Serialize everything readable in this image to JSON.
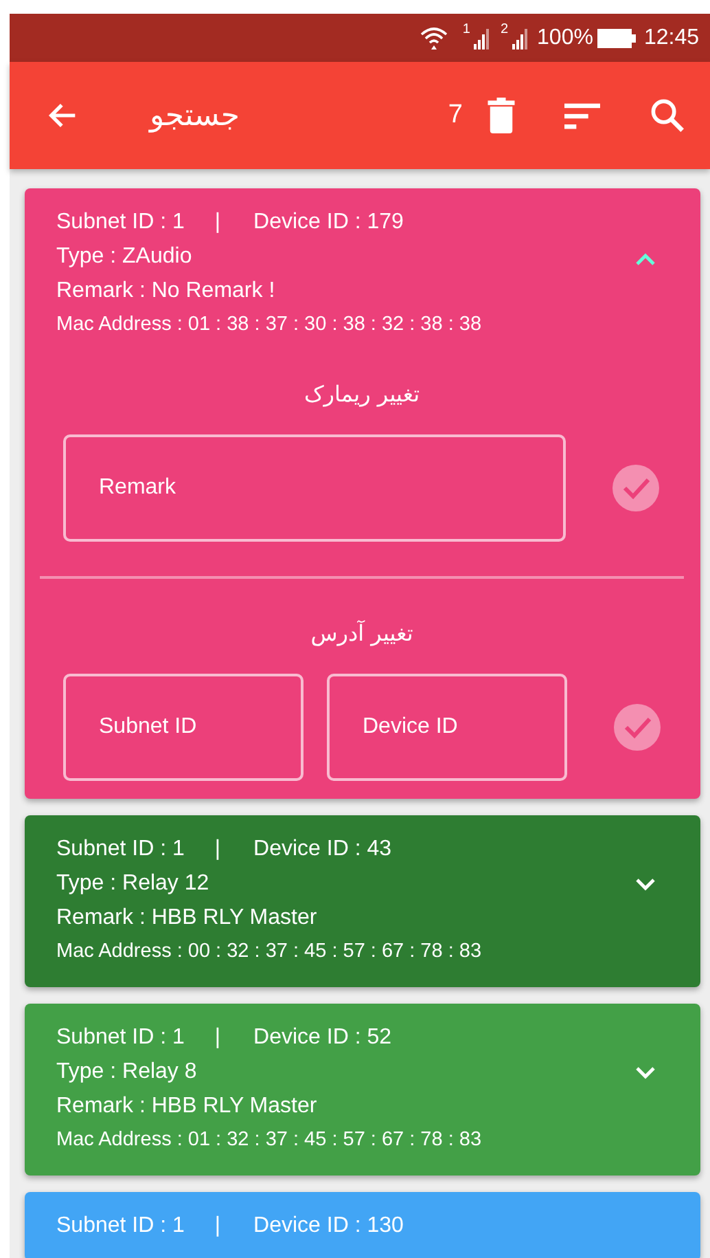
{
  "status_bar": {
    "sim_labels": [
      "1",
      "2"
    ],
    "battery": "100%",
    "time": "12:45"
  },
  "toolbar": {
    "title": "جستجو",
    "count": "7"
  },
  "devices": [
    {
      "color": "#ec407a",
      "expanded": true,
      "subnet": "Subnet ID : 1",
      "separator": "|",
      "device": "Device ID : 179",
      "type": "Type : ZAudio",
      "remark": "Remark : No Remark !",
      "mac": "Mac Address : 01 : 38 : 37 : 30 : 38 : 32 : 38 : 38",
      "edit": {
        "remark_title": "تغییر ریمارک",
        "remark_placeholder": "Remark",
        "address_title": "تغییر آدرس",
        "subnet_placeholder": "Subnet ID",
        "device_placeholder": "Device ID"
      }
    },
    {
      "color": "#2e7d32",
      "expanded": false,
      "subnet": "Subnet ID : 1",
      "separator": "|",
      "device": "Device ID : 43",
      "type": "Type : Relay 12",
      "remark": "Remark : HBB RLY Master",
      "mac": "Mac Address : 00 : 32 : 37 : 45 : 57 : 67 : 78 : 83"
    },
    {
      "color": "#43a047",
      "expanded": false,
      "subnet": "Subnet ID : 1",
      "separator": "|",
      "device": "Device ID : 52",
      "type": "Type : Relay 8",
      "remark": "Remark : HBB RLY Master",
      "mac": "Mac Address : 01 : 32 : 37 : 45 : 57 : 67 : 78 : 83"
    },
    {
      "color": "#42a5f5",
      "subnet": "Subnet ID : 1",
      "separator": "|",
      "device": "Device ID : 130"
    }
  ]
}
